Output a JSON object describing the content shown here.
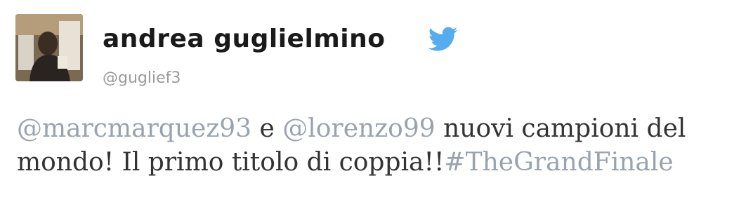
{
  "user": {
    "display_name": "andrea guglielmino",
    "handle": "@guglief3",
    "avatar_icon": "user-avatar-photo"
  },
  "icons": {
    "brand": "twitter-bird-icon",
    "brand_color": "#55acee"
  },
  "tweet": {
    "mention_1": "@marcmarquez93",
    "text_1": " e ",
    "mention_2": "@lorenzo99",
    "text_2": " nuovi campioni del mondo! Il primo titolo di coppia!!",
    "hashtag": "#TheGrandFinale"
  },
  "colors": {
    "link": "#9aa3ad",
    "text": "#333333",
    "name": "#1a1a1a",
    "handle": "#9a9a9a"
  }
}
